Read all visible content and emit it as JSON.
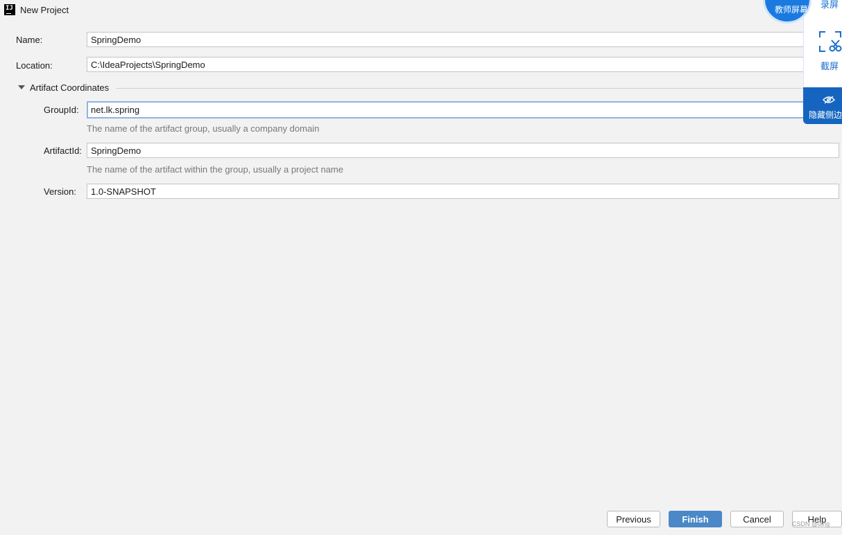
{
  "window": {
    "title": "New Project",
    "icon": "intellij-idea-icon"
  },
  "form": {
    "name_label": "Name:",
    "name_value": "SpringDemo",
    "location_label": "Location:",
    "location_value": "C:\\IdeaProjects\\SpringDemo",
    "section_title": "Artifact Coordinates",
    "groupid_label": "GroupId:",
    "groupid_value": "net.lk.spring",
    "groupid_hint": "The name of the artifact group, usually a company domain",
    "artifactid_label": "ArtifactId:",
    "artifactid_value": "SpringDemo",
    "artifactid_hint": "The name of the artifact within the group, usually a project name",
    "version_label": "Version:",
    "version_value": "1.0-SNAPSHOT"
  },
  "buttons": {
    "previous": "Previous",
    "finish": "Finish",
    "cancel": "Cancel",
    "help": "Help"
  },
  "overlay": {
    "teacher_label": "教师屏幕",
    "record_label": "录屏",
    "screenshot_label": "截屏",
    "hide_label": "隐藏侧边",
    "screenshot_icon": "crop-icon",
    "hide_icon": "eye-icon"
  },
  "watermark": "CSDN @uing",
  "colors": {
    "primary_button": "#4a88c7",
    "focus_border": "#8fb4e0",
    "overlay_blue": "#1565c0"
  }
}
